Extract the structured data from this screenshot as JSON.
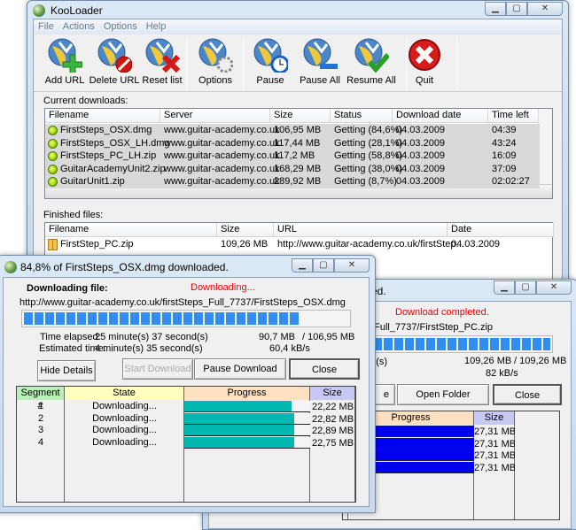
{
  "main": {
    "title": "KooLoader",
    "menu": [
      "File",
      "Actions",
      "Options",
      "Help"
    ],
    "toolbar": [
      {
        "label": "Add URL",
        "icon": "globe-add-icon"
      },
      {
        "label": "Delete URL",
        "icon": "globe-delete-icon"
      },
      {
        "label": "Reset list",
        "icon": "globe-reset-icon"
      },
      {
        "label": "Options",
        "icon": "globe-gear-icon"
      },
      {
        "label": "Pause",
        "icon": "globe-clock-icon"
      },
      {
        "label": "Pause All",
        "icon": "globe-minus-icon"
      },
      {
        "label": "Resume All",
        "icon": "globe-check-icon"
      },
      {
        "label": "Quit",
        "icon": "quit-x-icon"
      }
    ],
    "current_label": "Current downloads:",
    "current_headers": [
      "Filename",
      "Server",
      "Size",
      "Status",
      "Download date",
      "Time left"
    ],
    "current_rows": [
      [
        "FirstSteps_OSX.dmg",
        "www.guitar-academy.co.uk",
        "106,95 MB",
        "Getting (84,6%)",
        "04.03.2009",
        "04:39"
      ],
      [
        "FirstSteps_OSX_LH.dmg",
        "www.guitar-academy.co.uk",
        "117,44 MB",
        "Getting (28,1%)",
        "04.03.2009",
        "43:24"
      ],
      [
        "FirstSteps_PC_LH.zip",
        "www.guitar-academy.co.uk",
        "117,2 MB",
        "Getting (58,8%)",
        "04.03.2009",
        "16:09"
      ],
      [
        "GuitarAcademyUnit2.zip",
        "www.guitar-academy.co.uk",
        "168,29 MB",
        "Getting (38,0%)",
        "04.03.2009",
        "37:09"
      ],
      [
        "GuitarUnit1.zip",
        "www.guitar-academy.co.uk",
        "289,92 MB",
        "Getting (8,7%)",
        "04.03.2009",
        "02:02:27"
      ]
    ],
    "finished_label": "Finished files:",
    "finished_headers": [
      "Filename",
      "Size",
      "URL",
      "Date"
    ],
    "finished_rows": [
      [
        "FirstStep_PC.zip",
        "109,26 MB",
        "http://www.guitar-academy.co.uk/firstStep...",
        "04.03.2009"
      ]
    ]
  },
  "dialog1": {
    "title": "84,8% of FirstSteps_OSX.dmg downloaded.",
    "file_label": "Downloading file:",
    "status": "Downloading...",
    "url": "http://www.guitar-academy.co.uk/firstSteps_Full_7737/FirstSteps_OSX.dmg",
    "progress_percent": 84.8,
    "elapsed_label": "Time elapsed:",
    "elapsed": "25 minute(s) 37 second(s)",
    "estimated_label": "Estimated time:",
    "estimated": "4 minute(s) 35 second(s)",
    "downloaded": "90,7 MB",
    "total": "/ 106,95 MB",
    "speed": "60,4 kB/s",
    "buttons": {
      "hide": "Hide Details",
      "start": "Start Download",
      "pause": "Pause Download",
      "close": "Close"
    },
    "grid_headers": [
      "Segment #",
      "State",
      "Progress",
      "Size"
    ],
    "segments": [
      {
        "n": "1",
        "state": "Downloading...",
        "progress": 85,
        "size": "22,22 MB"
      },
      {
        "n": "2",
        "state": "Downloading...",
        "progress": 87,
        "size": "22,82 MB"
      },
      {
        "n": "3",
        "state": "Downloading...",
        "progress": 87,
        "size": "22,89 MB"
      },
      {
        "n": "4",
        "state": "Downloading...",
        "progress": 87,
        "size": "22,75 MB"
      }
    ]
  },
  "dialog2": {
    "title_partial": "ed.",
    "status": "Download completed.",
    "url_partial": "_Full_7737/FirstStep_PC.zip",
    "progress_percent": 100,
    "elapsed_partial": "nd(s)",
    "downloaded": "109,26 MB",
    "total": "/ 109,26 MB",
    "speed": "82 kB/s",
    "buttons": {
      "partial": "e",
      "open": "Open Folder",
      "close": "Close"
    },
    "grid_headers": [
      "Progress",
      "Size"
    ],
    "segments": [
      {
        "progress": 100,
        "size": "27,31 MB"
      },
      {
        "progress": 100,
        "size": "27,31 MB"
      },
      {
        "progress": 100,
        "size": "27,31 MB"
      },
      {
        "progress": 100,
        "size": "27,31 MB"
      }
    ]
  },
  "colors": {
    "seg_fill": "#00b8b0",
    "done_fill": "#0000f0",
    "status_red": "#e00000",
    "progress_blue": "#2f8ef0",
    "hdr_green": "#b8f0b8",
    "hdr_yellow": "#ffffc0",
    "hdr_peach": "#fde0c0",
    "hdr_lavender": "#c8c8f4"
  }
}
